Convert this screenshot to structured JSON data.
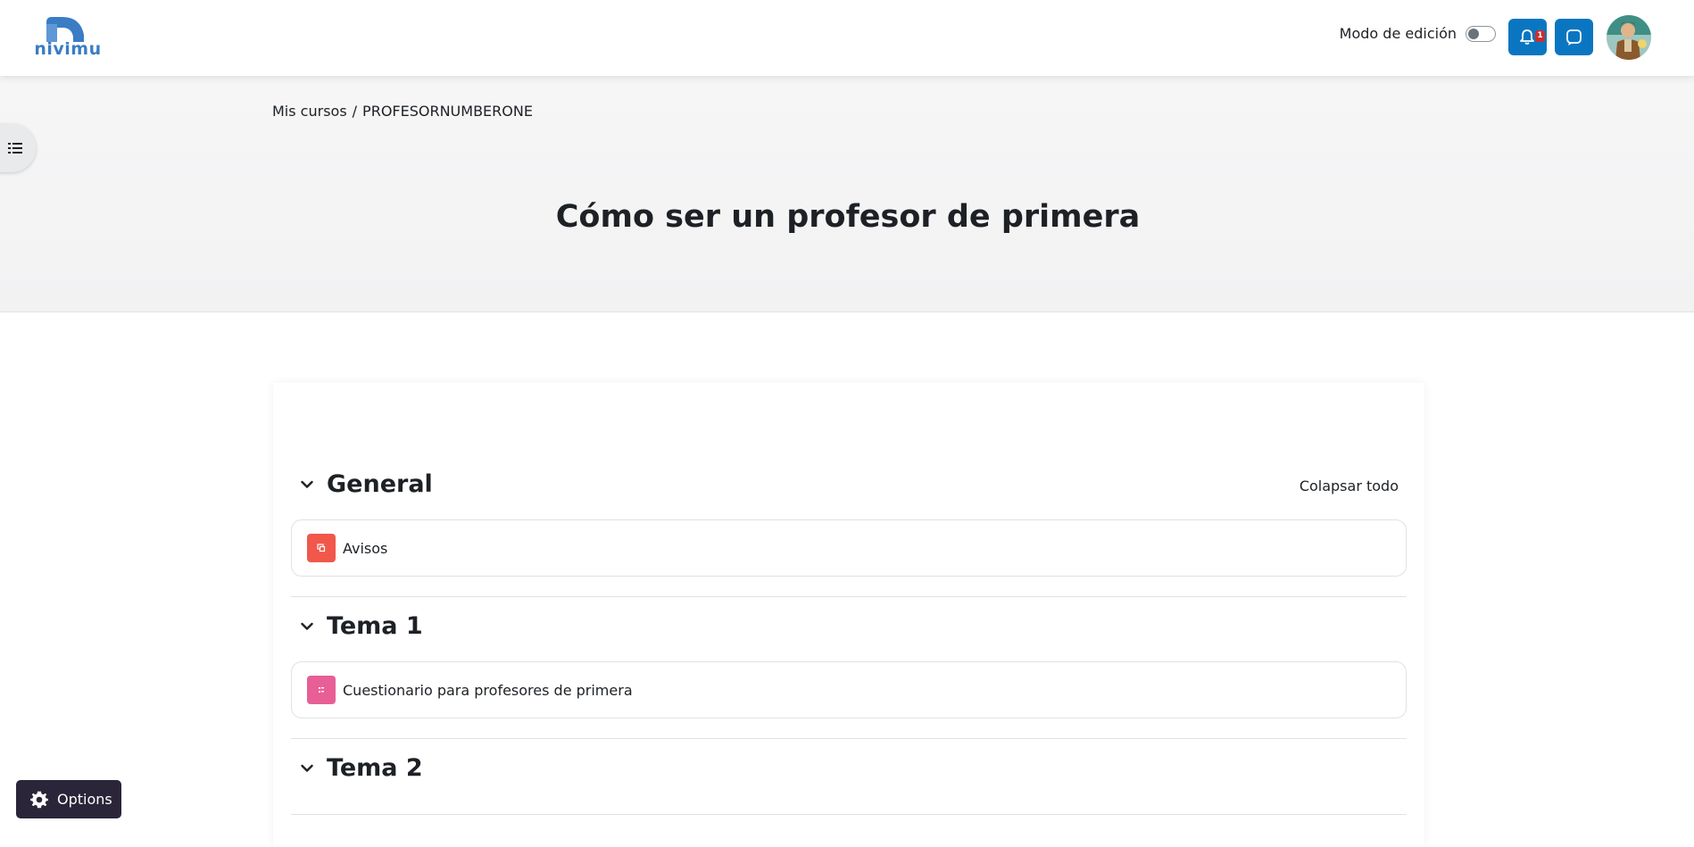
{
  "brand": {
    "logo_text": "nivimu"
  },
  "header": {
    "edit_mode_label": "Modo de edición",
    "notifications_count": "1"
  },
  "breadcrumb": {
    "item1": "Mis cursos",
    "separator": "/",
    "item2": "PROFESORNUMBERONE"
  },
  "page_title": "Cómo ser un profesor de primera",
  "course": {
    "collapse_all": "Colapsar todo",
    "sections": [
      {
        "title": "General",
        "activities": [
          {
            "name": "Avisos",
            "icon": "forum-icon",
            "color": "#f1574a"
          }
        ]
      },
      {
        "title": "Tema 1",
        "activities": [
          {
            "name": "Cuestionario para profesores de primera",
            "icon": "quiz-icon",
            "color": "#e85e96"
          }
        ]
      },
      {
        "title": "Tema 2",
        "activities": []
      }
    ]
  },
  "options_button": "Options",
  "colors": {
    "brand_blue": "#0a76c1",
    "title": "#1d2125",
    "options_bg": "#2a2538"
  }
}
